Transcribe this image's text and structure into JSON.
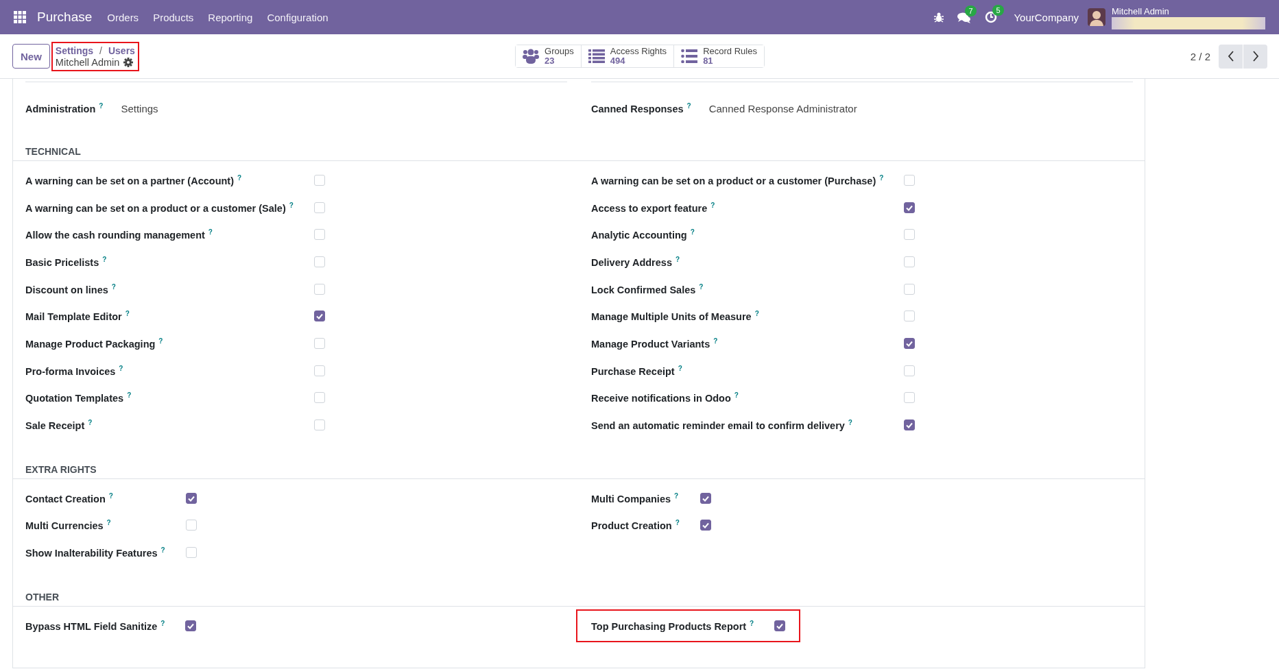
{
  "navbar": {
    "app": "Purchase",
    "menu": [
      "Orders",
      "Products",
      "Reporting",
      "Configuration"
    ],
    "messages_badge": "7",
    "activities_badge": "5",
    "company": "YourCompany",
    "user": "Mitchell Admin"
  },
  "control_panel": {
    "new_button": "New",
    "breadcrumb": [
      "Settings",
      "Users"
    ],
    "breadcrumb_separator": "/",
    "record": "Mitchell Admin",
    "highlighted": true,
    "smart_buttons": [
      {
        "kind": "groups",
        "label": "Groups",
        "count": "23"
      },
      {
        "kind": "access",
        "label": "Access Rights",
        "count": "494"
      },
      {
        "kind": "rules",
        "label": "Record Rules",
        "count": "81"
      }
    ],
    "pager": "2 / 2"
  },
  "top_fields": [
    {
      "label": "Administration",
      "help": "?",
      "value": "Settings"
    },
    {
      "label": "Canned Responses",
      "help": "?",
      "value": "Canned Response Administrator"
    }
  ],
  "sections": [
    {
      "title": "TECHNICAL",
      "columns": [
        [
          {
            "label": "A warning can be set on a partner (Account)",
            "help": "?",
            "checked": false,
            "highlighted": false
          },
          {
            "label": "A warning can be set on a product or a customer (Sale)",
            "help": "?",
            "checked": false,
            "highlighted": false
          },
          {
            "label": "Allow the cash rounding management",
            "help": "?",
            "checked": false,
            "highlighted": false
          },
          {
            "label": "Basic Pricelists",
            "help": "?",
            "checked": false,
            "highlighted": false
          },
          {
            "label": "Discount on lines",
            "help": "?",
            "checked": false,
            "highlighted": false
          },
          {
            "label": "Mail Template Editor",
            "help": "?",
            "checked": true,
            "highlighted": false
          },
          {
            "label": "Manage Product Packaging",
            "help": "?",
            "checked": false,
            "highlighted": false
          },
          {
            "label": "Pro-forma Invoices",
            "help": "?",
            "checked": false,
            "highlighted": false
          },
          {
            "label": "Quotation Templates",
            "help": "?",
            "checked": false,
            "highlighted": false
          },
          {
            "label": "Sale Receipt",
            "help": "?",
            "checked": false,
            "highlighted": false
          }
        ],
        [
          {
            "label": "A warning can be set on a product or a customer (Purchase)",
            "help": "?",
            "checked": false,
            "highlighted": false
          },
          {
            "label": "Access to export feature",
            "help": "?",
            "checked": true,
            "highlighted": false
          },
          {
            "label": "Analytic Accounting",
            "help": "?",
            "checked": false,
            "highlighted": false
          },
          {
            "label": "Delivery Address",
            "help": "?",
            "checked": false,
            "highlighted": false
          },
          {
            "label": "Lock Confirmed Sales",
            "help": "?",
            "checked": false,
            "highlighted": false
          },
          {
            "label": "Manage Multiple Units of Measure",
            "help": "?",
            "checked": false,
            "highlighted": false
          },
          {
            "label": "Manage Product Variants",
            "help": "?",
            "checked": true,
            "highlighted": false
          },
          {
            "label": "Purchase Receipt",
            "help": "?",
            "checked": false,
            "highlighted": false
          },
          {
            "label": "Receive notifications in Odoo",
            "help": "?",
            "checked": false,
            "highlighted": false
          },
          {
            "label": "Send an automatic reminder email to confirm delivery",
            "help": "?",
            "checked": true,
            "highlighted": false
          }
        ]
      ]
    },
    {
      "title": "EXTRA RIGHTS",
      "columns": [
        [
          {
            "label": "Contact Creation",
            "help": "?",
            "checked": true,
            "highlighted": false
          },
          {
            "label": "Multi Currencies",
            "help": "?",
            "checked": false,
            "highlighted": false
          },
          {
            "label": "Show Inalterability Features",
            "help": "?",
            "checked": false,
            "highlighted": false
          }
        ],
        [
          {
            "label": "Multi Companies",
            "help": "?",
            "checked": true,
            "highlighted": false
          },
          {
            "label": "Product Creation",
            "help": "?",
            "checked": true,
            "highlighted": false
          }
        ]
      ]
    },
    {
      "title": "OTHER",
      "columns": [
        [
          {
            "label": "Bypass HTML Field Sanitize",
            "help": "?",
            "checked": true,
            "highlighted": false
          }
        ],
        [
          {
            "label": "Top Purchasing Products Report",
            "help": "?",
            "checked": true,
            "highlighted": true
          }
        ]
      ]
    }
  ]
}
